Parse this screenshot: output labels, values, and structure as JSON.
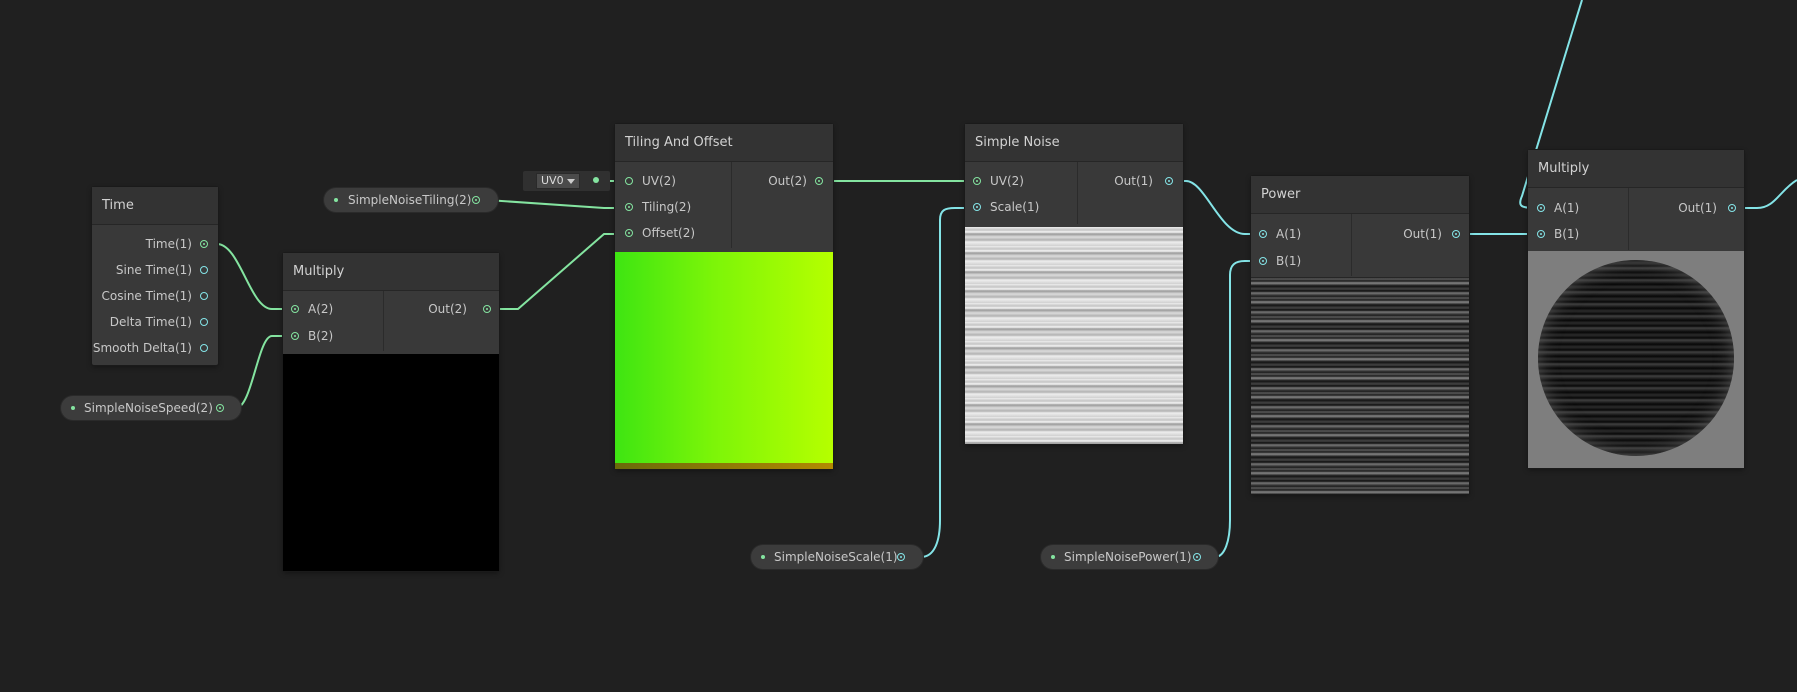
{
  "colors": {
    "vector_wire": "#84e4a0",
    "scalar_wire": "#84e4e7",
    "background": "#202020"
  },
  "nodes": {
    "time": {
      "title": "Time",
      "outputs": [
        "Time(1)",
        "Sine Time(1)",
        "Cosine Time(1)",
        "Delta Time(1)",
        "Smooth Delta(1)"
      ]
    },
    "multiply_a": {
      "title": "Multiply",
      "inputs": [
        "A(2)",
        "B(2)"
      ],
      "output": "Out(2)"
    },
    "tiling": {
      "title": "Tiling And Offset",
      "inputs": [
        "UV(2)",
        "Tiling(2)",
        "Offset(2)"
      ],
      "output": "Out(2)",
      "uv_value": "UV0"
    },
    "simple_noise": {
      "title": "Simple Noise",
      "inputs": [
        "UV(2)",
        "Scale(1)"
      ],
      "output": "Out(1)"
    },
    "power": {
      "title": "Power",
      "inputs": [
        "A(1)",
        "B(1)"
      ],
      "output": "Out(1)"
    },
    "multiply_b": {
      "title": "Multiply",
      "inputs": [
        "A(1)",
        "B(1)"
      ],
      "output": "Out(1)"
    }
  },
  "properties": {
    "tiling": "SimpleNoiseTiling(2)",
    "speed": "SimpleNoiseSpeed(2)",
    "scale": "SimpleNoiseScale(1)",
    "power": "SimpleNoisePower(1)"
  }
}
